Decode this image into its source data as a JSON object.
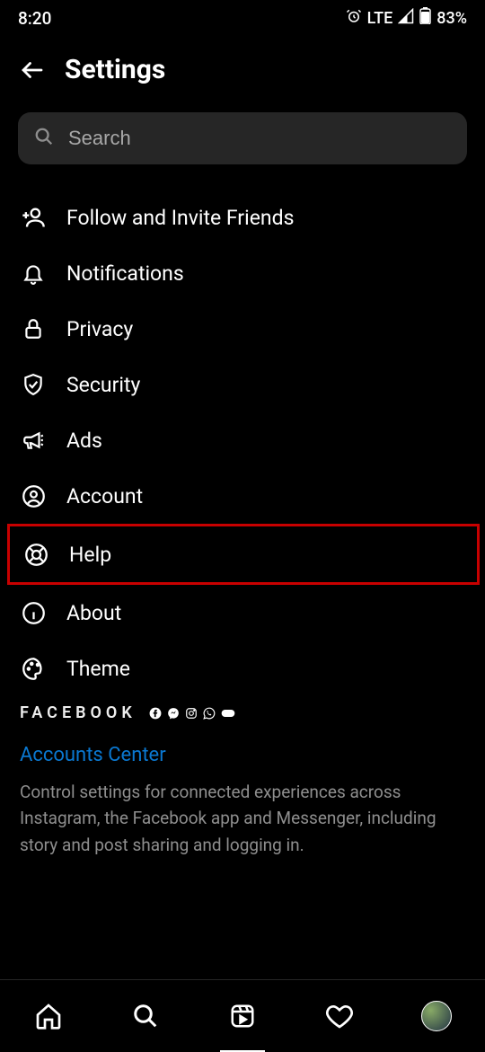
{
  "status_bar": {
    "time": "8:20",
    "network": "LTE",
    "battery": "83%"
  },
  "header": {
    "title": "Settings"
  },
  "search": {
    "placeholder": "Search"
  },
  "menu": {
    "items": [
      {
        "label": "Follow and Invite Friends"
      },
      {
        "label": "Notifications"
      },
      {
        "label": "Privacy"
      },
      {
        "label": "Security"
      },
      {
        "label": "Ads"
      },
      {
        "label": "Account"
      },
      {
        "label": "Help"
      },
      {
        "label": "About"
      },
      {
        "label": "Theme"
      }
    ]
  },
  "footer": {
    "brand": "FACEBOOK",
    "accounts_center": "Accounts Center",
    "description": "Control settings for connected experiences across Instagram, the Facebook app and Messenger, including story and post sharing and logging in."
  }
}
